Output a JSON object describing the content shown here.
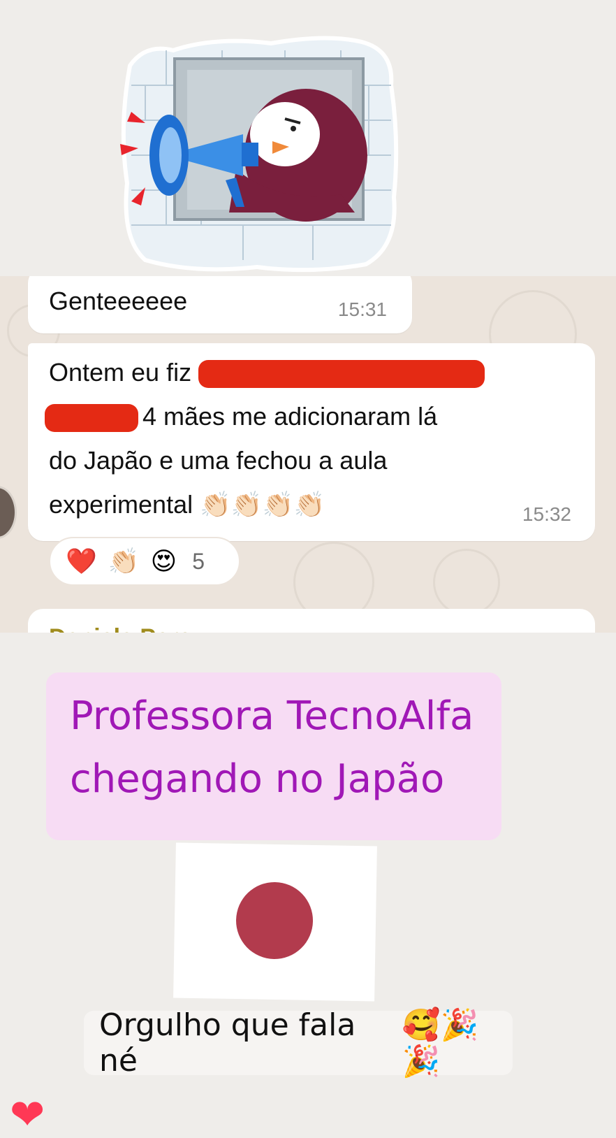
{
  "chat": {
    "messages": [
      {
        "text": "Genteeeeee",
        "time": "15:31"
      },
      {
        "lines": [
          {
            "prefix": "Ontem eu fiz",
            "suffix": ""
          },
          {
            "prefix": "",
            "suffix": "4 mães me adicionaram lá"
          },
          {
            "prefix": "do Japão e uma fechou a aula",
            "suffix": ""
          },
          {
            "prefix": "experimental 👏🏻👏🏻👏🏻👏🏻",
            "suffix": ""
          }
        ],
        "time": "15:32"
      }
    ],
    "reactions": {
      "emojis": [
        "❤️",
        "👏🏻",
        "😍"
      ],
      "count": "5"
    },
    "next_sender": "Daniela Perez"
  },
  "story": {
    "caption_lines": [
      "Professora TecnoAlfa",
      "chegando no Japão"
    ],
    "pride_text": "Orgulho que fala né",
    "pride_emojis": "🥰🎉🎉"
  },
  "colors": {
    "caption_text": "#a018b6",
    "caption_bg": "#f7dcf4",
    "flag_disc": "#b23b4d",
    "redaction": "#e42a14",
    "megaphone": "#1f6fd1",
    "penguin": "#7a1f3d"
  },
  "icons": [
    "megaphone-penguin-sticker",
    "japan-flag",
    "heart-icon"
  ]
}
